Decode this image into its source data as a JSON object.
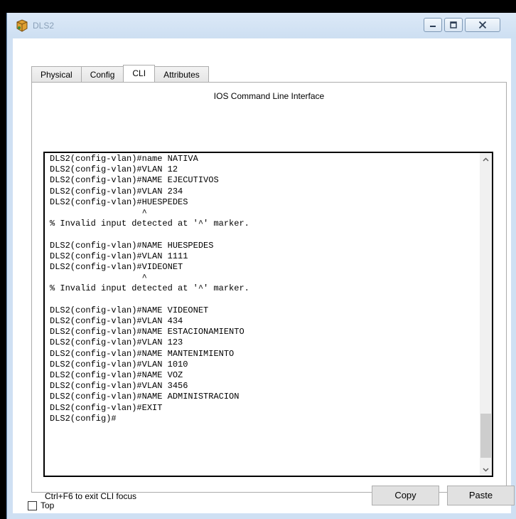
{
  "window": {
    "title": "DLS2",
    "colors": {
      "frame": "#cfe0f3",
      "title_text": "#8aa0b8"
    }
  },
  "tabs": [
    {
      "label": "Physical",
      "active": false
    },
    {
      "label": "Config",
      "active": false
    },
    {
      "label": "CLI",
      "active": true
    },
    {
      "label": "Attributes",
      "active": false
    }
  ],
  "cli": {
    "heading": "IOS Command Line Interface",
    "lines": [
      "DLS2(config-vlan)#name NATIVA",
      "DLS2(config-vlan)#VLAN 12",
      "DLS2(config-vlan)#NAME EJECUTIVOS",
      "DLS2(config-vlan)#VLAN 234",
      "DLS2(config-vlan)#HUESPEDES",
      "                  ^",
      "% Invalid input detected at '^' marker.",
      "",
      "DLS2(config-vlan)#NAME HUESPEDES",
      "DLS2(config-vlan)#VLAN 1111",
      "DLS2(config-vlan)#VIDEONET",
      "                  ^",
      "% Invalid input detected at '^' marker.",
      "",
      "DLS2(config-vlan)#NAME VIDEONET",
      "DLS2(config-vlan)#VLAN 434",
      "DLS2(config-vlan)#NAME ESTACIONAMIENTO",
      "DLS2(config-vlan)#VLAN 123",
      "DLS2(config-vlan)#NAME MANTENIMIENTO",
      "DLS2(config-vlan)#VLAN 1010",
      "DLS2(config-vlan)#NAME VOZ",
      "DLS2(config-vlan)#VLAN 3456",
      "DLS2(config-vlan)#NAME ADMINISTRACION",
      "DLS2(config-vlan)#EXIT",
      "DLS2(config)#"
    ],
    "hint": "Ctrl+F6 to exit CLI focus",
    "copy_label": "Copy",
    "paste_label": "Paste"
  },
  "footer": {
    "top_checkbox_label": "Top",
    "top_checked": false
  },
  "icons": {
    "app": "packet-tracer-switch-icon",
    "minimize": "minimize-icon",
    "maximize": "maximize-icon",
    "close": "close-icon"
  }
}
